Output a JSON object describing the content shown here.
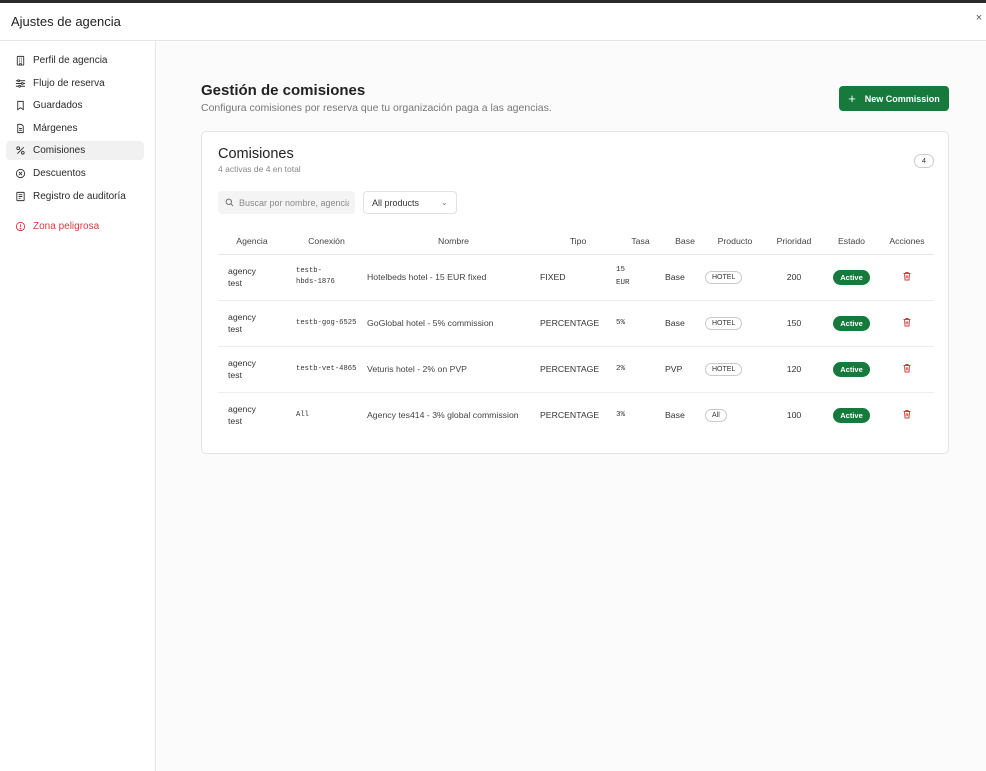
{
  "window": {
    "title": "Ajustes de agencia",
    "close_label": "×"
  },
  "sidebar": {
    "items": [
      {
        "label": "Perfil de agencia",
        "icon": "building-icon"
      },
      {
        "label": "Flujo de reserva",
        "icon": "sliders-icon"
      },
      {
        "label": "Guardados",
        "icon": "bookmark-icon"
      },
      {
        "label": "Márgenes",
        "icon": "document-icon"
      },
      {
        "label": "Comisiones",
        "icon": "percent-icon"
      },
      {
        "label": "Descuentos",
        "icon": "circle-x-icon"
      },
      {
        "label": "Registro de auditoría",
        "icon": "log-icon"
      }
    ],
    "danger": {
      "label": "Zona peligrosa",
      "icon": "alert-circle-icon"
    }
  },
  "page": {
    "title": "Gestión de comisiones",
    "subtitle": "Configura comisiones por reserva que tu organización paga a las agencias.",
    "new_button": "New Commission"
  },
  "card": {
    "title": "Comisiones",
    "subtitle": "4 activas de 4 en total",
    "count": "4",
    "search_placeholder": "Buscar por nombre, agencia",
    "filter_selected": "All products"
  },
  "table": {
    "headers": [
      "Agencia",
      "Conexión",
      "Nombre",
      "Tipo",
      "Tasa",
      "Base",
      "Producto",
      "Prioridad",
      "Estado",
      "Acciones"
    ],
    "rows": [
      {
        "agency": "agency test",
        "connection": "testb-hbds-1876",
        "name": "Hotelbeds hotel - 15 EUR fixed",
        "type": "FIXED",
        "rate": "15 EUR",
        "base": "Base",
        "product": "HOTEL",
        "priority": "200",
        "status": "Active"
      },
      {
        "agency": "agency test",
        "connection": "testb-gog-6525",
        "name": "GoGlobal hotel - 5% commission",
        "type": "PERCENTAGE",
        "rate": "5%",
        "base": "Base",
        "product": "HOTEL",
        "priority": "150",
        "status": "Active"
      },
      {
        "agency": "agency test",
        "connection": "testb-vet-4865",
        "name": "Veturis hotel - 2% on PVP",
        "type": "PERCENTAGE",
        "rate": "2%",
        "base": "PVP",
        "product": "HOTEL",
        "priority": "120",
        "status": "Active"
      },
      {
        "agency": "agency test",
        "connection": "All",
        "name": "Agency tes414 - 3% global commission",
        "type": "PERCENTAGE",
        "rate": "3%",
        "base": "Base",
        "product": "All",
        "priority": "100",
        "status": "Active"
      }
    ]
  },
  "colors": {
    "accent": "#167a3c",
    "danger": "#d23c3c"
  }
}
